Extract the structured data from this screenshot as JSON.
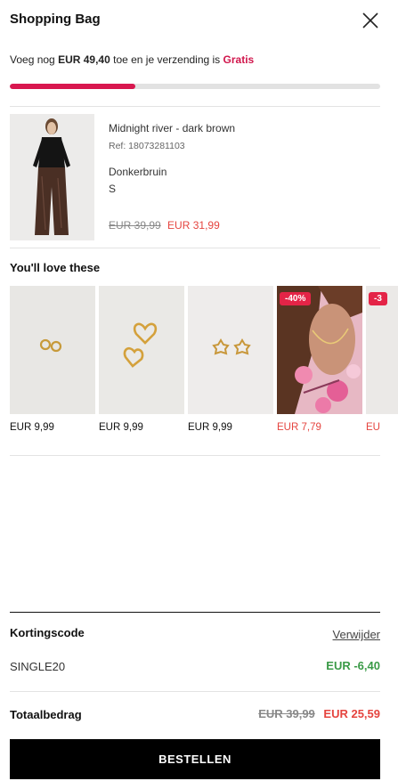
{
  "header": {
    "title": "Shopping Bag"
  },
  "shipping": {
    "prefix": "Voeg nog",
    "amount": "EUR 49,40",
    "middle": "toe en je verzending is",
    "free_label": "Gratis",
    "progress_percent": 34
  },
  "cart_item": {
    "name": "Midnight river - dark brown",
    "ref": "Ref: 18073281103",
    "color": "Donkerbruin",
    "size": "S",
    "old_price": "EUR 39,99",
    "new_price": "EUR 31,99"
  },
  "recommendations": {
    "title": "You'll love these",
    "items": [
      {
        "price": "EUR 9,99",
        "sale": false,
        "badge": ""
      },
      {
        "price": "EUR 9,99",
        "sale": false,
        "badge": ""
      },
      {
        "price": "EUR 9,99",
        "sale": false,
        "badge": ""
      },
      {
        "price": "EUR 7,79",
        "sale": true,
        "badge": "-40%"
      },
      {
        "price": "EU",
        "sale": true,
        "badge": "-3"
      }
    ]
  },
  "discount": {
    "label": "Kortingscode",
    "remove_label": "Verwijder",
    "code": "SINGLE20",
    "amount": "EUR -6,40"
  },
  "total": {
    "label": "Totaalbedrag",
    "old_price": "EUR 39,99",
    "new_price": "EUR 25,59"
  },
  "checkout": {
    "button_label": "BESTELLEN"
  },
  "colors": {
    "accent": "#d8174f",
    "sale": "#e5443f",
    "discount": "#3a9a47",
    "button": "#000000"
  }
}
